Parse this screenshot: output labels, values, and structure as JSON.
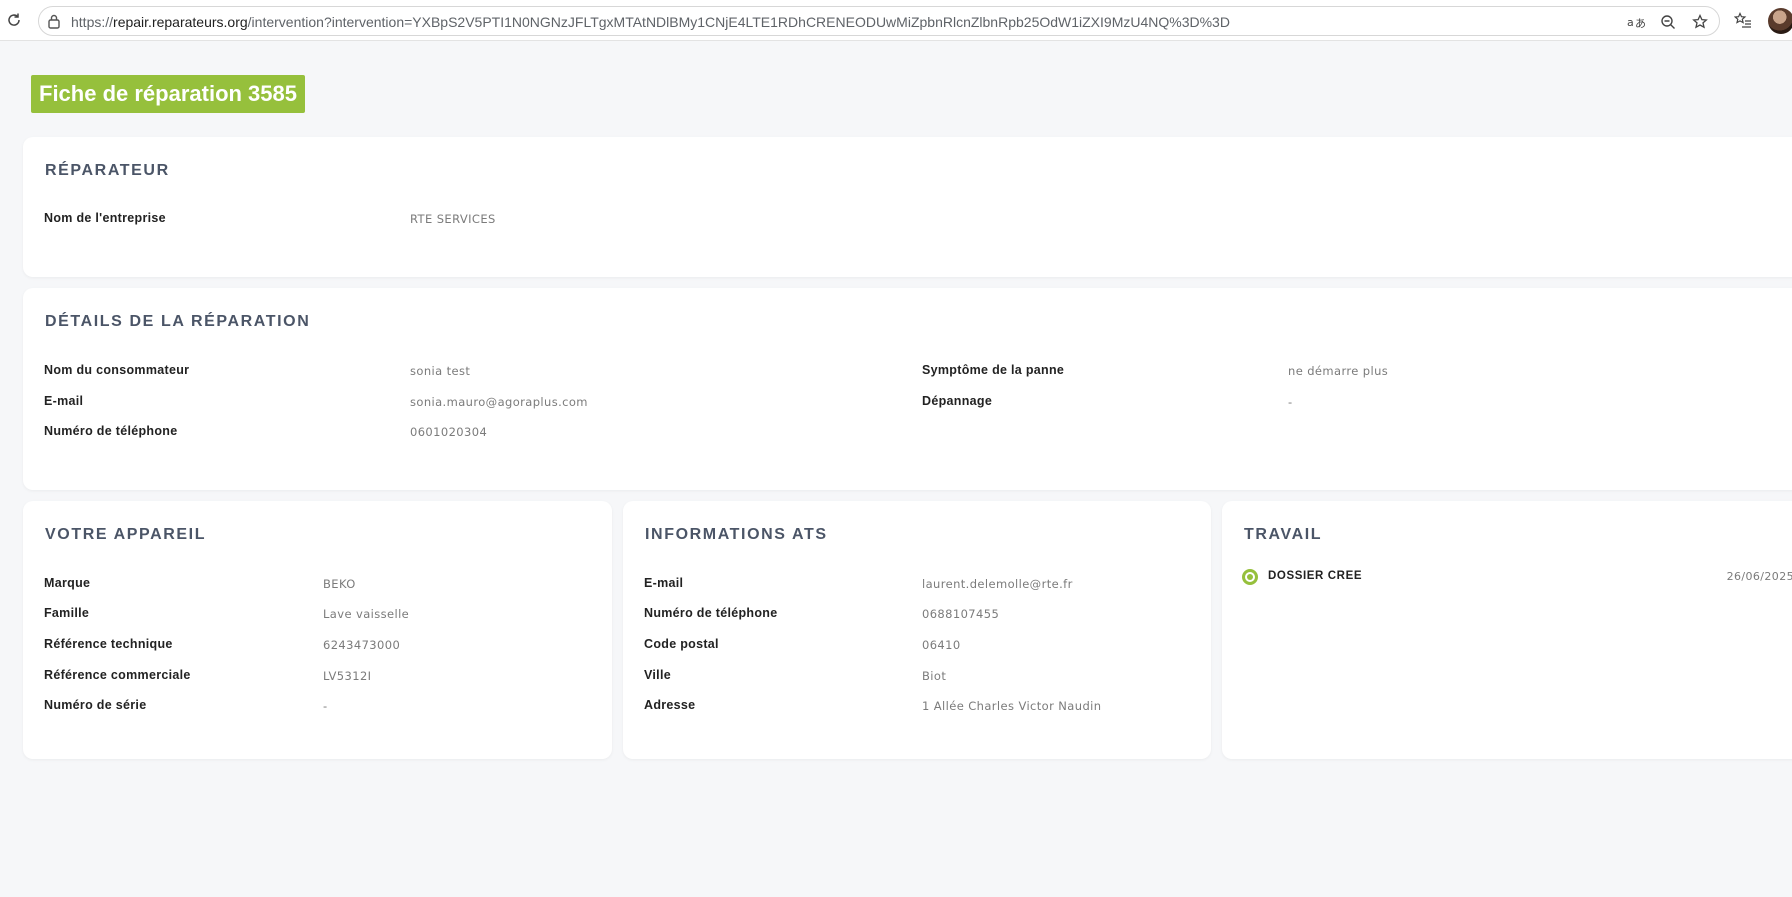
{
  "browser": {
    "url_prefix": "https://",
    "url_host": "repair.reparateurs.org",
    "url_path": "/intervention?intervention=YXBpS2V5PTI1N0NGNzJFLTgxMTAtNDlBMy1CNjE4LTE1RDhCRENEODUwMiZpbnRlcnZlbnRpb25OdW1iZXI9MzU4NQ%3D%3D"
  },
  "page": {
    "title": "Fiche de réparation 3585"
  },
  "repairer": {
    "title": "RÉPARATEUR",
    "company_label": "Nom de l'entreprise",
    "company_value": "RTE SERVICES"
  },
  "details": {
    "title": "DÉTAILS DE LA RÉPARATION",
    "consumer_label": "Nom du consommateur",
    "consumer_value": "sonia test",
    "email_label": "E-mail",
    "email_value": "sonia.mauro@agoraplus.com",
    "phone_label": "Numéro de téléphone",
    "phone_value": "0601020304",
    "symptom_label": "Symptôme de la panne",
    "symptom_value": "ne démarre plus",
    "depannage_label": "Dépannage",
    "depannage_value": "-"
  },
  "device": {
    "title": "VOTRE APPAREIL",
    "rows": [
      {
        "label": "Marque",
        "value": "BEKO"
      },
      {
        "label": "Famille",
        "value": "Lave vaisselle"
      },
      {
        "label": "Référence technique",
        "value": "6243473000"
      },
      {
        "label": "Référence commerciale",
        "value": "LV5312I"
      },
      {
        "label": "Numéro de série",
        "value": "-"
      }
    ]
  },
  "ats": {
    "title": "INFORMATIONS ATS",
    "rows": [
      {
        "label": "E-mail",
        "value": "laurent.delemolle@rte.fr"
      },
      {
        "label": "Numéro de téléphone",
        "value": "0688107455"
      },
      {
        "label": "Code postal",
        "value": "06410"
      },
      {
        "label": "Ville",
        "value": "Biot"
      },
      {
        "label": "Adresse",
        "value": "1 Allée Charles Victor Naudin"
      }
    ]
  },
  "work": {
    "title": "TRAVAIL",
    "status_label": "DOSSIER CREE",
    "status_date": "26/06/2025"
  },
  "colors": {
    "accent": "#96c03c",
    "heading": "#4b5567",
    "value": "#7b7b7b"
  }
}
